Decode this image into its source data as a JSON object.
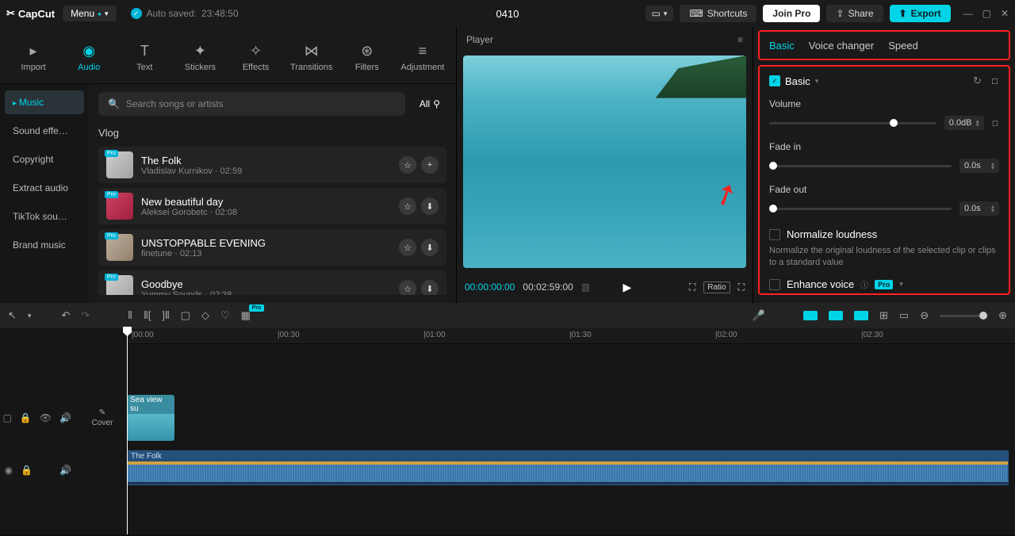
{
  "app": {
    "name": "CapCut",
    "menu": "Menu",
    "autosave_prefix": "Auto saved:",
    "autosave_time": "23:48:50",
    "project_title": "0410"
  },
  "titlebar": {
    "shortcuts": "Shortcuts",
    "join_pro": "Join Pro",
    "share": "Share",
    "export": "Export"
  },
  "tool_tabs": [
    {
      "label": "Import"
    },
    {
      "label": "Audio"
    },
    {
      "label": "Text"
    },
    {
      "label": "Stickers"
    },
    {
      "label": "Effects"
    },
    {
      "label": "Transitions"
    },
    {
      "label": "Filters"
    },
    {
      "label": "Adjustment"
    }
  ],
  "categories": [
    {
      "label": "Music",
      "active": true
    },
    {
      "label": "Sound effe…"
    },
    {
      "label": "Copyright"
    },
    {
      "label": "Extract audio"
    },
    {
      "label": "TikTok sou…"
    },
    {
      "label": "Brand music"
    }
  ],
  "search": {
    "placeholder": "Search songs or artists",
    "filter_all": "All"
  },
  "section_header": "Vlog",
  "tracks": [
    {
      "title": "The Folk",
      "artist": "Vladislav Kurnikov",
      "dur": "02:59",
      "dl": false
    },
    {
      "title": "New beautiful day",
      "artist": "Aleksei Gorobetc",
      "dur": "02:08",
      "dl": true
    },
    {
      "title": "UNSTOPPABLE EVENING",
      "artist": "finetune",
      "dur": "02:13",
      "dl": true
    },
    {
      "title": "Goodbye",
      "artist": "Yummy Sounds",
      "dur": "02:38",
      "dl": true
    }
  ],
  "player": {
    "title": "Player",
    "time_current": "00:00:00:00",
    "time_duration": "00:02:59:00",
    "ratio": "Ratio"
  },
  "inspector": {
    "tabs": {
      "basic": "Basic",
      "voice": "Voice changer",
      "speed": "Speed"
    },
    "basic_header": "Basic",
    "volume": {
      "label": "Volume",
      "value": "0.0dB"
    },
    "fadein": {
      "label": "Fade in",
      "value": "0.0s"
    },
    "fadeout": {
      "label": "Fade out",
      "value": "0.0s"
    },
    "normalize": {
      "label": "Normalize loudness",
      "desc": "Normalize the original loudness of the selected clip or clips to a standard value"
    },
    "enhance": {
      "label": "Enhance voice",
      "badge": "Pro"
    }
  },
  "timeline": {
    "marks": [
      "00:00",
      "00:30",
      "01:00",
      "01:30",
      "02:00",
      "02:30"
    ],
    "video_clip_label": "Sea view su",
    "audio_clip_label": "The Folk",
    "cover": "Cover"
  }
}
